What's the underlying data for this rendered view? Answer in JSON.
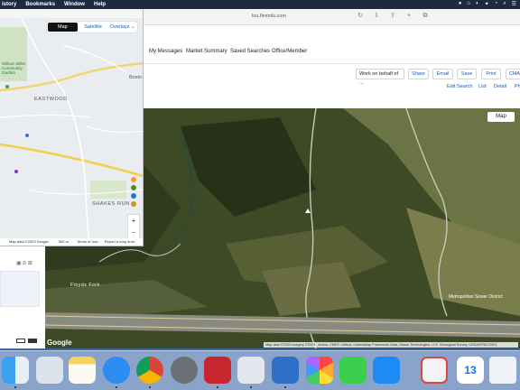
{
  "menubar": {
    "items": [
      "istory",
      "Bookmarks",
      "Window",
      "Help"
    ],
    "status_icons": [
      "●",
      "⌂",
      "◐",
      "✦",
      "◔",
      "⌕",
      "☰"
    ]
  },
  "browser": {
    "url": "lou.flexmls.com"
  },
  "app_nav": [
    "My Messages",
    "Market Summary",
    "Saved Searches",
    "Office/Member"
  ],
  "actions": {
    "work_on_behalf": "Work on behalf of ...",
    "buttons": [
      "Share",
      "Email",
      "Save",
      "Print",
      "CMA"
    ]
  },
  "view_links": [
    "Edit Search",
    "List",
    "Detail",
    "Ph"
  ],
  "satellite": {
    "map_button": "Map",
    "google": "Google",
    "attribution": "Map data ©2023 Imagery ©2023 , Airbus, CNES / Airbus, IndianaMap Framework Data, Maxar Technologies, U.S. Geological Survey, USDA/FPAC/GEO",
    "scale": "100 m",
    "labels": {
      "floyds_fork": "Floyds Fork",
      "sewer": "Metropolitan Sewer District"
    }
  },
  "map_window": {
    "tabs": [
      "Map",
      "Satellite",
      "Overlays ⌄"
    ],
    "active_tab": "Map",
    "places": {
      "eastwood": "EASTWOOD",
      "shakes_run": "SHAKES RUN",
      "boston": "Bosto",
      "williams": "William Miller Community Garden"
    },
    "attribution": "Map data ©2023 Google",
    "scale": "500 m",
    "terms": "Terms of Use",
    "report": "Report a map error",
    "zoom_in": "+",
    "zoom_out": "−"
  },
  "dock_apps": [
    "Finder",
    "Launchpad",
    "Notes",
    "Safari",
    "Chrome",
    "System Preferences",
    "Quicken",
    "Preview",
    "Word",
    "Photos",
    "Messages",
    "App Store",
    "Gmail",
    "Calendar",
    "Trash"
  ],
  "calendar_day": "13"
}
